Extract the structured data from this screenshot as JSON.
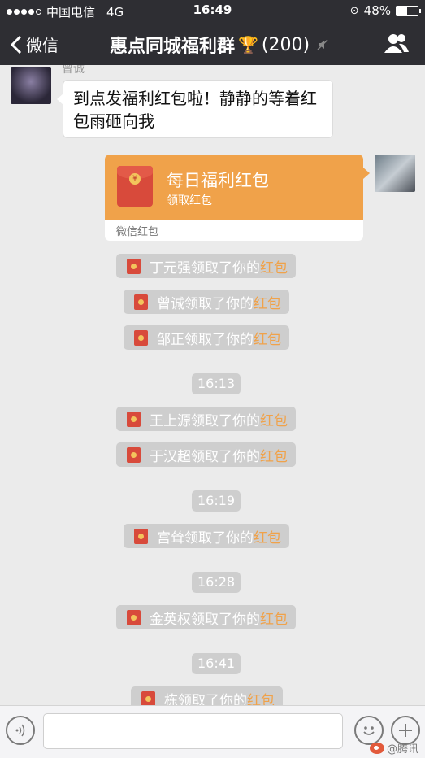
{
  "status_bar": {
    "carrier": "中国电信",
    "network": "4G",
    "time": "16:49",
    "battery": "48%",
    "battery_level": 0.48
  },
  "nav": {
    "back_label": "微信",
    "title": "惠点同城福利群",
    "trophy": "🏆",
    "member_count": "(200)"
  },
  "messages": {
    "sender_name": "曾诚",
    "text": "到点发福利红包啦！静静的等着红包雨砸向我",
    "red_packet": {
      "title": "每日福利红包",
      "subtitle": "领取红包",
      "footer": "微信红包",
      "coin_symbol": "¥"
    }
  },
  "system": {
    "suffix": "领取了你的",
    "highlight": "红包",
    "highlight_color": "#f0a24a",
    "claims": [
      "丁元强",
      "曾诚",
      "邹正",
      "王上源",
      "于汉超",
      "宫耸",
      "金英权",
      "栋"
    ],
    "times": [
      "16:13",
      "16:19",
      "16:28",
      "16:41"
    ]
  },
  "input_bar": {
    "placeholder": ""
  },
  "watermark": {
    "text": "@腾讯"
  }
}
